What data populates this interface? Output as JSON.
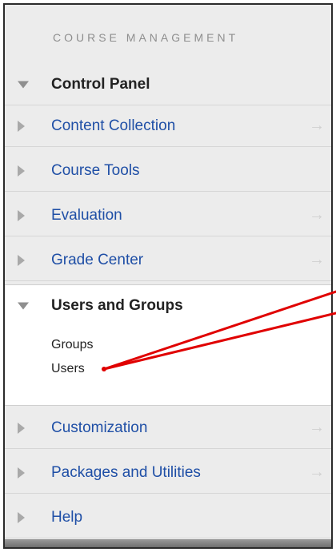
{
  "section_title": "COURSE MANAGEMENT",
  "control_panel": {
    "label": "Control Panel"
  },
  "items_top": [
    {
      "label": "Content Collection"
    },
    {
      "label": "Course Tools"
    },
    {
      "label": "Evaluation"
    },
    {
      "label": "Grade Center"
    }
  ],
  "users_groups": {
    "label": "Users and Groups",
    "children": [
      "Groups",
      "Users"
    ]
  },
  "items_bottom": [
    {
      "label": "Customization"
    },
    {
      "label": "Packages and Utilities"
    },
    {
      "label": "Help"
    }
  ],
  "arrow_glyph": "→",
  "colors": {
    "link": "#1f4fa6",
    "annotation": "#e00000",
    "panel_bg": "#ececec"
  }
}
